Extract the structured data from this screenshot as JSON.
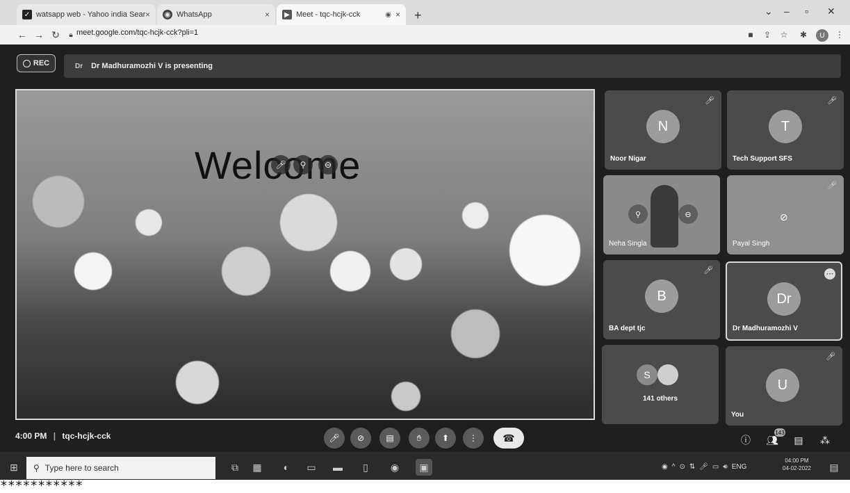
{
  "browser": {
    "tabs": [
      {
        "label": "watsapp web - Yahoo india Sear",
        "close": "×"
      },
      {
        "label": "WhatsApp",
        "close": "×"
      },
      {
        "label": "Meet - tqc-hcjk-cck",
        "close": "×"
      }
    ],
    "new_tab": "+",
    "url": "meet.google.com/tqc-hcjk-cck?pli=1",
    "profile_initial": "U"
  },
  "meet": {
    "rec_label": "REC",
    "presenter_initial": "Dr",
    "presenting_text": "Dr Madhuramozhi V is presenting",
    "slide_text": "Welcome",
    "participants": [
      {
        "initial": "N",
        "name": "Noor Nigar",
        "muted": true
      },
      {
        "initial": "T",
        "name": "Tech Support SFS",
        "muted": true
      },
      {
        "initial": "",
        "name": "Neha Singla",
        "muted": false
      },
      {
        "initial": "",
        "name": "Payal Singh",
        "muted": true
      },
      {
        "initial": "B",
        "name": "BA dept tjc",
        "muted": true
      },
      {
        "initial": "Dr",
        "name": "Dr Madhuramozhi V",
        "muted": false
      },
      {
        "initial": "S",
        "name": "141 others",
        "muted": false
      },
      {
        "initial": "U",
        "name": "You",
        "muted": true
      }
    ],
    "time": "4:00 PM",
    "separator": "|",
    "meeting_code": "tqc-hcjk-cck",
    "people_count": "143"
  },
  "taskbar": {
    "search_placeholder": "Type here to search",
    "language": "ENG",
    "time": "04:00 PM",
    "date": "04-02-2022"
  },
  "footer_mark": "***********"
}
